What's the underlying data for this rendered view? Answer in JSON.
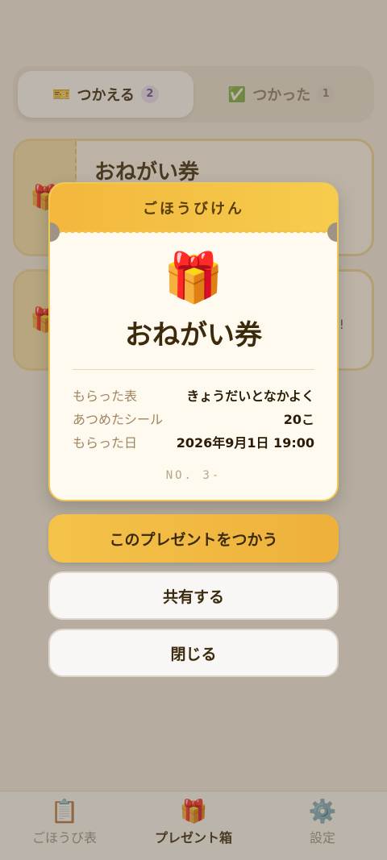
{
  "tabs": [
    {
      "icon": "🎫",
      "label": "つかえる",
      "count": "2"
    },
    {
      "icon": "✅",
      "label": "つかった",
      "count": "1"
    }
  ],
  "cards": [
    {
      "icon": "🎁",
      "title": "おねがい券"
    },
    {
      "icon": "🎁",
      "title": "",
      "trailing": "!"
    }
  ],
  "modal": {
    "header": "ごほうびけん",
    "icon": "🎁",
    "title": "おねがい券",
    "rows": [
      {
        "label": "もらった表",
        "value": "きょうだいとなかよく"
      },
      {
        "label": "あつめたシール",
        "value": "20こ"
      },
      {
        "label": "もらった日",
        "value": "2026年9月1日 19:00"
      }
    ],
    "number": "NO. 3-"
  },
  "buttons": {
    "use": "このプレゼントをつかう",
    "share": "共有する",
    "close": "閉じる"
  },
  "nav": [
    {
      "icon": "📋",
      "label": "ごほうび表"
    },
    {
      "icon": "🎁",
      "label": "プレゼント箱"
    },
    {
      "icon": "⚙️",
      "label": "設定"
    }
  ]
}
